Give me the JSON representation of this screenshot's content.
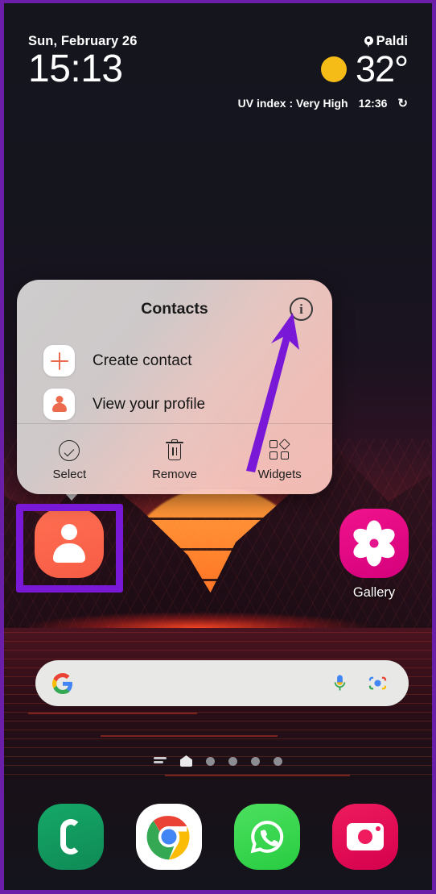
{
  "frame": {
    "accent_purple": "#7a18d8"
  },
  "weather_widget": {
    "date": "Sun, February 26",
    "location": "Paldi",
    "location_icon": "location-pin-icon",
    "time": "15:13",
    "weather_icon": "sun-icon",
    "temperature": "32°",
    "uv_index": "UV index : Very High",
    "updated_time": "12:36",
    "refresh_icon": "refresh-icon"
  },
  "popup": {
    "title": "Contacts",
    "info_icon": "info-icon",
    "info_glyph": "i",
    "items": [
      {
        "label": "Create contact",
        "icon": "plus-icon"
      },
      {
        "label": "View your profile",
        "icon": "person-icon"
      }
    ],
    "actions": [
      {
        "label": "Select",
        "icon": "check-circle-icon"
      },
      {
        "label": "Remove",
        "icon": "trash-icon"
      },
      {
        "label": "Widgets",
        "icon": "widgets-icon"
      }
    ]
  },
  "annotation": {
    "arrow_color": "#7a18d8",
    "highlight_color": "#7a18d8"
  },
  "home_apps": [
    {
      "label": "",
      "icon": "contacts-app-icon",
      "color": "#ff6f52"
    },
    {
      "label": "Gallery",
      "icon": "gallery-app-icon",
      "color": "#f0138c"
    }
  ],
  "search": {
    "value": "",
    "placeholder": "",
    "google_icon": "google-g-icon",
    "mic_icon": "microphone-icon",
    "lens_icon": "google-lens-icon"
  },
  "page_indicator": {
    "lines_icon": "list-lines-icon",
    "home_icon": "home-page-icon",
    "dots": 4
  },
  "dock": [
    {
      "label": "",
      "icon": "phone-app-icon",
      "color": "#15a867"
    },
    {
      "label": "",
      "icon": "chrome-app-icon",
      "color": "#ffffff"
    },
    {
      "label": "",
      "icon": "whatsapp-app-icon",
      "color": "#28cc41"
    },
    {
      "label": "",
      "icon": "camera-app-icon",
      "color": "#ef1b5e"
    }
  ]
}
